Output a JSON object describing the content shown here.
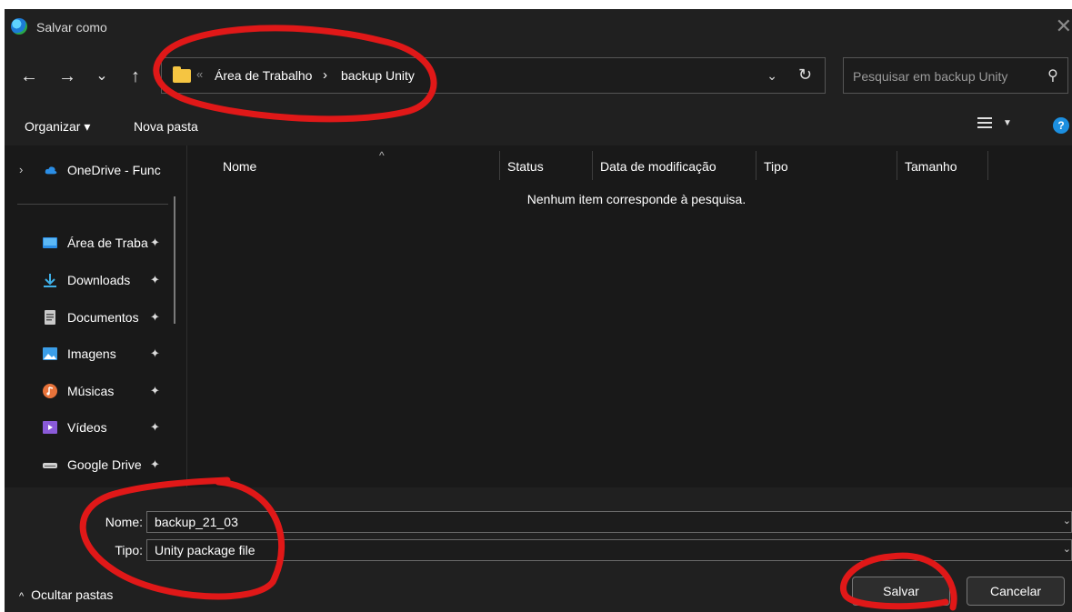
{
  "window": {
    "title": "Salvar como"
  },
  "nav": {
    "back": "←",
    "forward": "→",
    "recent": "⌄",
    "up": "↑"
  },
  "address": {
    "overflow": "«",
    "breadcrumbs": [
      "Área de Trabalho",
      "backup Unity"
    ],
    "separator": "›",
    "dropdown": "⌄",
    "refresh": "↻"
  },
  "search": {
    "placeholder": "Pesquisar em backup Unity"
  },
  "commandbar": {
    "organize": "Organizar ▾",
    "new_folder": "Nova pasta",
    "help": "?"
  },
  "sidebar": {
    "onedrive": "OneDrive - Func",
    "items": [
      {
        "label": "Área de Traba",
        "icon": "desktop-icon",
        "color": "#2b8ee6"
      },
      {
        "label": "Downloads",
        "icon": "download-icon",
        "color": "#3fb0e8"
      },
      {
        "label": "Documentos",
        "icon": "document-icon",
        "color": "#c9c9c9"
      },
      {
        "label": "Imagens",
        "icon": "image-icon",
        "color": "#3b9ee8"
      },
      {
        "label": "Músicas",
        "icon": "music-icon",
        "color": "#e8733a"
      },
      {
        "label": "Vídeos",
        "icon": "video-icon",
        "color": "#8a5ad8"
      },
      {
        "label": "Google Drive",
        "icon": "drive-icon",
        "color": "#d0d0d0"
      }
    ],
    "pin": "📌"
  },
  "filelist": {
    "columns": [
      "Nome",
      "Status",
      "Data de modificação",
      "Tipo",
      "Tamanho"
    ],
    "empty_message": "Nenhum item corresponde à pesquisa."
  },
  "footer": {
    "name_label": "Nome:",
    "name_value": "backup_21_03",
    "type_label": "Tipo:",
    "type_value": "Unity package file",
    "hide_folders": "Ocultar pastas",
    "save": "Salvar",
    "cancel": "Cancelar"
  },
  "colors": {
    "annotation": "#e01818",
    "accent": "#1c8fe0"
  }
}
